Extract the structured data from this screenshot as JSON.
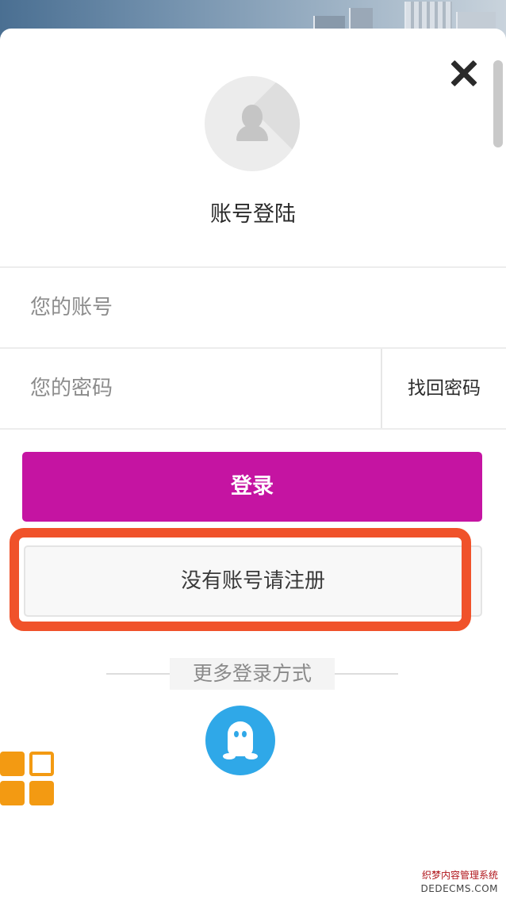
{
  "header": {
    "title": "账号登陆"
  },
  "form": {
    "account_placeholder": "您的账号",
    "password_placeholder": "您的密码",
    "find_password_label": "找回密码",
    "login_label": "登录",
    "register_label": "没有账号请注册"
  },
  "more": {
    "label": "更多登录方式",
    "providers": [
      "qq"
    ]
  },
  "icons": {
    "close": "close-icon",
    "avatar": "user-avatar-icon",
    "qq": "qq-icon",
    "menu": "grid-menu-icon"
  },
  "colors": {
    "login_button": "#c514a2",
    "highlight_border": "#f0522a",
    "qq_blue": "#2fa8e8",
    "menu_orange": "#f39a12"
  },
  "watermark": {
    "line1": "织梦内容管理系统",
    "line2": "DEDECMS.COM"
  }
}
